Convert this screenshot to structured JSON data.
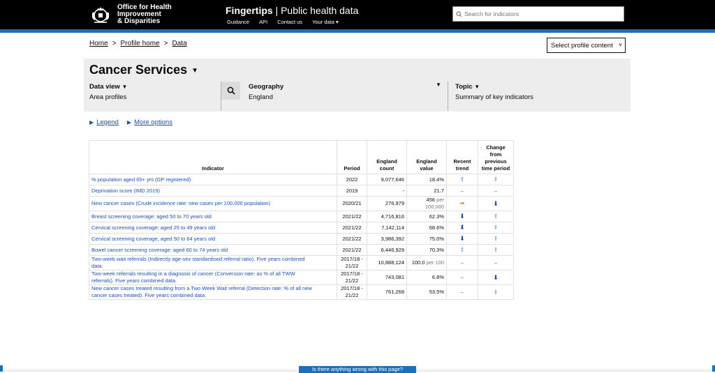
{
  "header": {
    "org_lines": [
      "Office for Health",
      "Improvement",
      "& Disparities"
    ],
    "brand_bold": "Fingertips",
    "brand_sep": " | ",
    "brand_rest": "Public health data",
    "nav": [
      "Guidance",
      "API",
      "Contact us",
      "Your data ▾"
    ],
    "search_placeholder": "Search for indicators"
  },
  "breadcrumb": [
    "Home",
    "Profile home",
    "Data"
  ],
  "breadcrumb_sep": ">",
  "profile_select": "Select profile content",
  "profile": {
    "title": "Cancer Services",
    "data_view_label": "Data view",
    "data_view_value": "Area profiles",
    "geography_label": "Geography",
    "geography_value": "England",
    "topic_label": "Topic",
    "topic_value": "Summary of key indicators"
  },
  "options": {
    "legend": "Legend",
    "more": "More options"
  },
  "table": {
    "headers": {
      "indicator": "Indicator",
      "period": "Period",
      "count": [
        "England",
        "count"
      ],
      "value": [
        "England",
        "value"
      ],
      "trend": [
        "Recent",
        "trend"
      ],
      "change": [
        "Change",
        "from",
        "previous",
        "time period"
      ]
    },
    "rows": [
      {
        "indicator": [
          "% population aged 65+ yrs (GP registered)"
        ],
        "period": [
          "2022"
        ],
        "count": "9,077,646",
        "value": "18.4%",
        "unit": "",
        "trend": "up",
        "change": "up"
      },
      {
        "indicator": [
          "Deprivation score (IMD 2019)"
        ],
        "period": [
          "2019"
        ],
        "count": "-",
        "value": "21.7",
        "unit": "",
        "trend": "dash",
        "change": "dash"
      },
      {
        "indicator": [
          "New cancer cases (Crude incidence rate: new cases per 100,000 population)"
        ],
        "period": [
          "2020/21"
        ],
        "count": "276,979",
        "value": "456",
        "unit": "per 100,000",
        "trend": "right",
        "change": "down"
      },
      {
        "indicator": [
          "Breast screening coverage: aged 50 to 70 years old"
        ],
        "period": [
          "2021/22"
        ],
        "count": "4,716,816",
        "value": "62.3%",
        "unit": "",
        "trend": "down",
        "change": "up"
      },
      {
        "indicator": [
          "Cervical screening coverage: aged 25 to 49 years old"
        ],
        "period": [
          "2021/22"
        ],
        "count": "7,142,114",
        "value": "68.6%",
        "unit": "",
        "trend": "down",
        "change": "up"
      },
      {
        "indicator": [
          "Cervical screening coverage, aged 50 to 64 years old"
        ],
        "period": [
          "2021/22"
        ],
        "count": "3,986,392",
        "value": "75.0%",
        "unit": "",
        "trend": "down",
        "change": "up"
      },
      {
        "indicator": [
          "Bowel cancer screening coverage: aged 60 to 74 years old"
        ],
        "period": [
          "2021/22"
        ],
        "count": "6,446,929",
        "value": "70.3%",
        "unit": "",
        "trend": "up",
        "change": "up"
      },
      {
        "indicator": [
          "Two-week wait referrals (Indirectly age-sex standardised referral ratio). Five years combined",
          "data."
        ],
        "period": [
          "2017/18 -",
          "21/22"
        ],
        "count": "10,888,124",
        "value": "100.0",
        "unit": "per 100",
        "trend": "dash",
        "change": "dash"
      },
      {
        "indicator": [
          "Two-week referrals resulting in a diagnosis of cancer (Conversion rate: as % of all TWW",
          "referrals). Five years combined data."
        ],
        "period": [
          "2017/18 -",
          "21/22"
        ],
        "count": "743,081",
        "value": "6.8%",
        "unit": "",
        "trend": "dash",
        "change": "down"
      },
      {
        "indicator": [
          "New cancer cases treated resulting from a Two Week Wait referral (Detection rate: % of all new",
          "cancer cases treated). Five years combined data."
        ],
        "period": [
          "2017/18 -",
          "21/22"
        ],
        "count": "761,268",
        "value": "53.5%",
        "unit": "",
        "trend": "dash",
        "change": "up"
      }
    ]
  },
  "feedback": "Is there anything wrong with this page?",
  "icons": {
    "up": "arrow-up-icon",
    "down": "arrow-down-icon",
    "right": "arrow-right-icon",
    "dash": "dash-icon"
  },
  "colors": {
    "header_bg": "#000000",
    "accent": "#1d70b8",
    "link": "#1d4fb8",
    "trend_up": "#9fbfe6",
    "trend_down": "#1849a9",
    "trend_right": "#e07b1a"
  }
}
